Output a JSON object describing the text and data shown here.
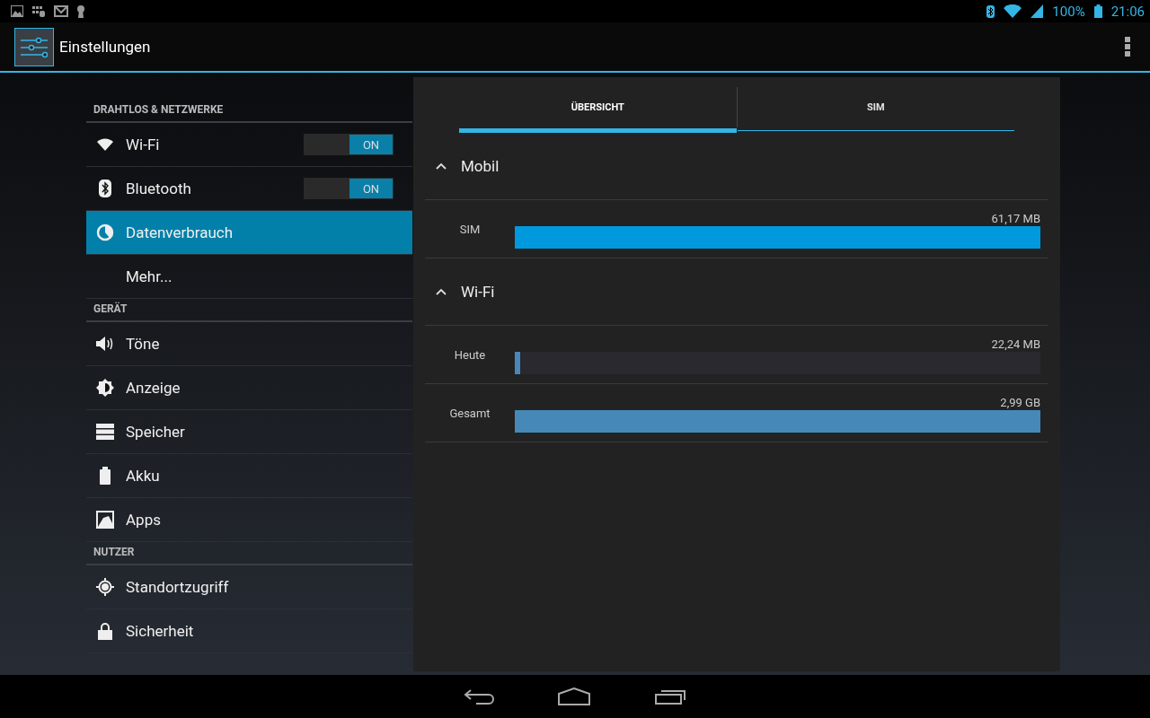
{
  "status_bar": {
    "battery": "100%",
    "time": "21:06"
  },
  "action_bar": {
    "title": "Einstellungen"
  },
  "sidebar": {
    "sections": [
      {
        "header": "DRAHTLOS & NETZWERKE",
        "items": [
          {
            "label": "Wi-Fi",
            "kind": "toggle",
            "selected": false,
            "toggle": {
              "text": "ON",
              "on": true
            }
          },
          {
            "label": "Bluetooth",
            "kind": "toggle",
            "selected": false,
            "toggle": {
              "text": "ON",
              "on": true
            }
          },
          {
            "label": "Datenverbrauch",
            "kind": "plain",
            "selected": true
          },
          {
            "label": "Mehr...",
            "kind": "plain",
            "selected": false
          }
        ]
      },
      {
        "header": "GERÄT",
        "items": [
          {
            "label": "Töne",
            "kind": "plain",
            "selected": false
          },
          {
            "label": "Anzeige",
            "kind": "plain",
            "selected": false
          },
          {
            "label": "Speicher",
            "kind": "plain",
            "selected": false
          },
          {
            "label": "Akku",
            "kind": "plain",
            "selected": false
          },
          {
            "label": "Apps",
            "kind": "plain",
            "selected": false
          }
        ]
      },
      {
        "header": "NUTZER",
        "items": [
          {
            "label": "Standortzugriff",
            "kind": "plain",
            "selected": false
          },
          {
            "label": "Sicherheit",
            "kind": "plain",
            "selected": false
          }
        ]
      }
    ]
  },
  "detail": {
    "tabs": [
      {
        "label": "ÜBERSICHT",
        "selected": true
      },
      {
        "label": "SIM",
        "selected": false
      }
    ],
    "groups": [
      {
        "title": "Mobil",
        "expanded": true,
        "color": "#0099dd",
        "rows": [
          {
            "label": "SIM",
            "amount": "61,17 MB",
            "level": 1
          }
        ]
      },
      {
        "title": "Wi-Fi",
        "expanded": true,
        "color": "#4689b8",
        "rows": [
          {
            "label": "Heute",
            "amount": "22,24 MB",
            "level": 0.01
          },
          {
            "label": "Gesamt",
            "amount": "2,99 GB",
            "level": 1
          }
        ]
      }
    ]
  }
}
